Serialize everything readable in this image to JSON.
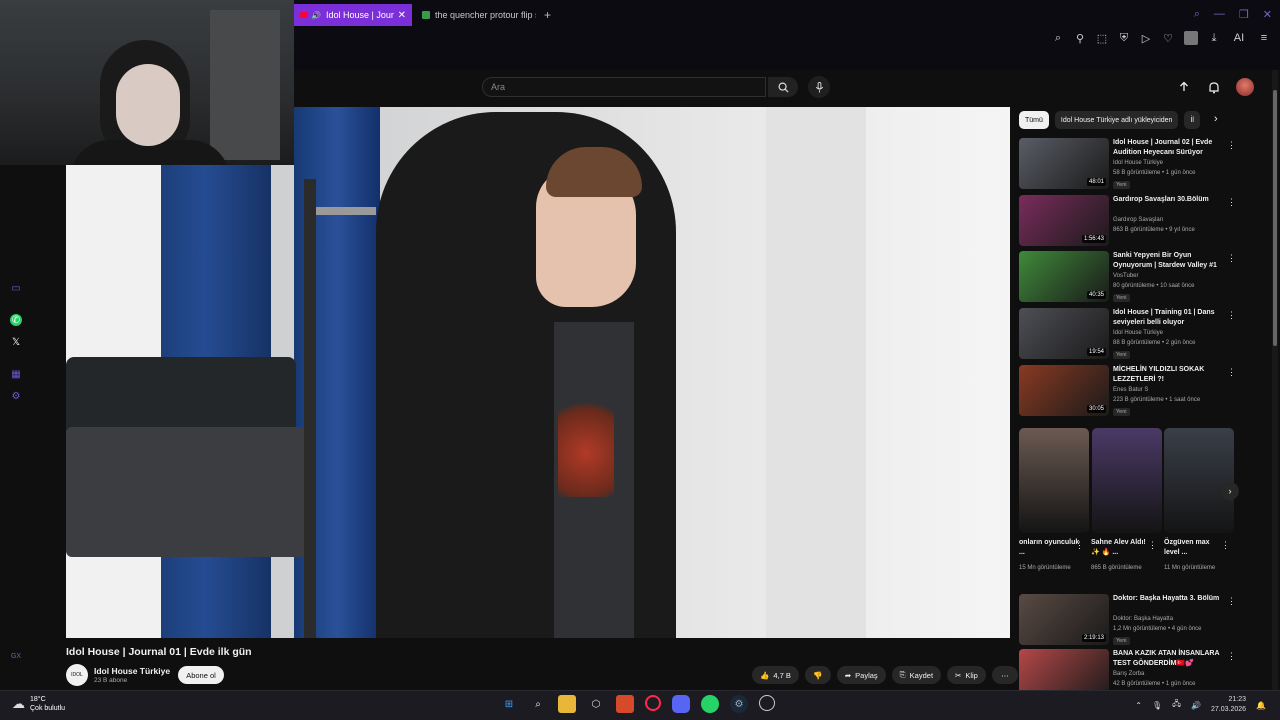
{
  "browser": {
    "tabs": [
      {
        "title": "Idol House | Journ",
        "active": true
      },
      {
        "title": "the quencher protour flip s",
        "active": false
      }
    ],
    "new_tab": "+",
    "toolbar_icons": [
      "search-icon",
      "pin-icon",
      "snapshot-icon",
      "shield-icon",
      "play-icon",
      "heart-icon",
      "profile-icon",
      "download-icon",
      "ai-icon",
      "menu-icon"
    ],
    "ai_label": "AI"
  },
  "youtube": {
    "search_placeholder": "Ara",
    "chips": [
      "Tümü",
      "Idol House Türkiye adlı yükleyiciden",
      "İl"
    ],
    "video": {
      "title": "Idol House | Journal 01 | Evde ilk gün",
      "channel": "Idol House Türkiye",
      "subs": "23 B abone",
      "subscribe": "Abone ol",
      "likes": "4,7 B",
      "share": "Paylaş",
      "save": "Kaydet",
      "clip": "Klip",
      "more": "⋯"
    },
    "recommendations": [
      {
        "title": "Idol House | Journal 02 | Evde Audition Heyecanı Sürüyor",
        "channel": "Idol House Türkiye",
        "views": "58 B görüntüleme • 1 gün önce",
        "badge": "Yeni",
        "duration": "48:01",
        "thumb_color": "#5a5d66"
      },
      {
        "title": "Gardırop Savaşları 30.Bölüm",
        "channel": "Gardırop Savaşları",
        "views": "863 B görüntüleme • 9 yıl önce",
        "badge": "",
        "duration": "1:56:43",
        "thumb_color": "#7a2c5c"
      },
      {
        "title": "Sanki Yepyeni Bir Oyun Oynuyorum | Stardew Valley #1",
        "channel": "VosTuber",
        "views": "80 görüntüleme • 10 saat önce",
        "badge": "Yeni",
        "duration": "40:35",
        "thumb_color": "#3f8a3a"
      },
      {
        "title": "Idol House | Training 01 | Dans seviyeleri belli oluyor",
        "channel": "Idol House Türkiye",
        "views": "88 B görüntüleme • 2 gün önce",
        "badge": "Yeni",
        "duration": "19:54",
        "thumb_color": "#4e4f55"
      },
      {
        "title": "MİCHELİN YILDIZLI SOKAK LEZZETLERİ ?!",
        "channel": "Enes Batur S",
        "views": "223 B görüntüleme • 1 saat önce",
        "badge": "Yeni",
        "duration": "30:05",
        "thumb_color": "#8a3a22"
      }
    ],
    "shorts": [
      {
        "title": "onların oyunculuk ...",
        "views": "15 Mn görüntüleme",
        "color": "#6b5a52"
      },
      {
        "title": "Sahne Alev Aldı!✨ 🔥 ...",
        "views": "865 B görüntüleme",
        "color": "#4a3a66"
      },
      {
        "title": "Özgüven max level ...",
        "views": "11 Mn görüntüleme",
        "color": "#3a3f48"
      }
    ],
    "recommendations2": [
      {
        "title": "Doktor: Başka Hayatta 3. Bölüm",
        "channel": "Doktor: Başka Hayatta",
        "views": "1,2 Mn görüntüleme • 4 gün önce",
        "badge": "Yeni",
        "duration": "2:19:13",
        "thumb_color": "#5a4a44"
      },
      {
        "title": "BANA KAZIK ATAN İNSANLARA TEST GÖNDERDİM🇹🇷💕",
        "channel": "Barış Zorba",
        "views": "42 B görüntüleme • 1 gün önce",
        "badge": "",
        "duration": "",
        "thumb_color": "#b44848"
      }
    ]
  },
  "taskbar": {
    "temp": "18°C",
    "weather": "Çok bulutlu",
    "time": "21:23",
    "date": "27.03.2026"
  }
}
